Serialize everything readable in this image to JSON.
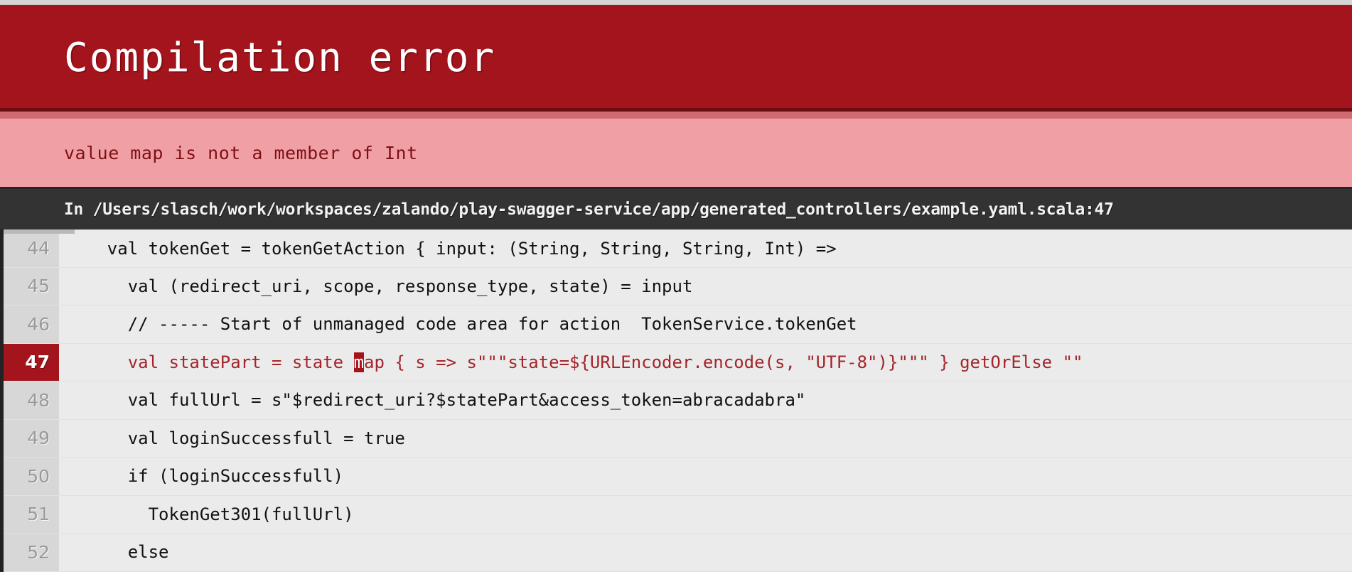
{
  "header": {
    "title": "Compilation error",
    "banner_color": "#a4141c"
  },
  "message": {
    "text": "value map is not a member of Int",
    "band_color": "#f0a0a5",
    "text_color": "#7d1015"
  },
  "location": {
    "prefix": "In ",
    "path": "/Users/slasch/work/workspaces/zalando/play-swagger-service/app/generated_controllers/example.yaml.scala:47",
    "full": "In /Users/slasch/work/workspaces/zalando/play-swagger-service/app/generated_controllers/example.yaml.scala:47",
    "bar_color": "#333333"
  },
  "code": {
    "error_line": "47",
    "error_highlight_color": "#a4141c",
    "error_text_color": "#a4242a",
    "lines": [
      {
        "number": "44",
        "text": "    val tokenGet = tokenGetAction { input: (String, String, String, Int) =>",
        "error": false
      },
      {
        "number": "45",
        "text": "      val (redirect_uri, scope, response_type, state) = input",
        "error": false
      },
      {
        "number": "46",
        "text": "      // ----- Start of unmanaged code area for action  TokenService.tokenGet",
        "error": false
      },
      {
        "number": "47",
        "pre": "      val statePart = state ",
        "mark": "m",
        "post": "ap { s => s\"\"\"state=${URLEncoder.encode(s, \"UTF-8\")}\"\"\" } getOrElse \"\"",
        "text": "      val statePart = state map { s => s\"\"\"state=${URLEncoder.encode(s, \"UTF-8\")}\"\"\" } getOrElse \"\"",
        "error": true
      },
      {
        "number": "48",
        "text": "      val fullUrl = s\"$redirect_uri?$statePart&access_token=abracadabra\"",
        "error": false
      },
      {
        "number": "49",
        "text": "      val loginSuccessfull = true",
        "error": false
      },
      {
        "number": "50",
        "text": "      if (loginSuccessfull)",
        "error": false
      },
      {
        "number": "51",
        "text": "        TokenGet301(fullUrl)",
        "error": false
      },
      {
        "number": "52",
        "text": "      else",
        "error": false
      }
    ]
  }
}
